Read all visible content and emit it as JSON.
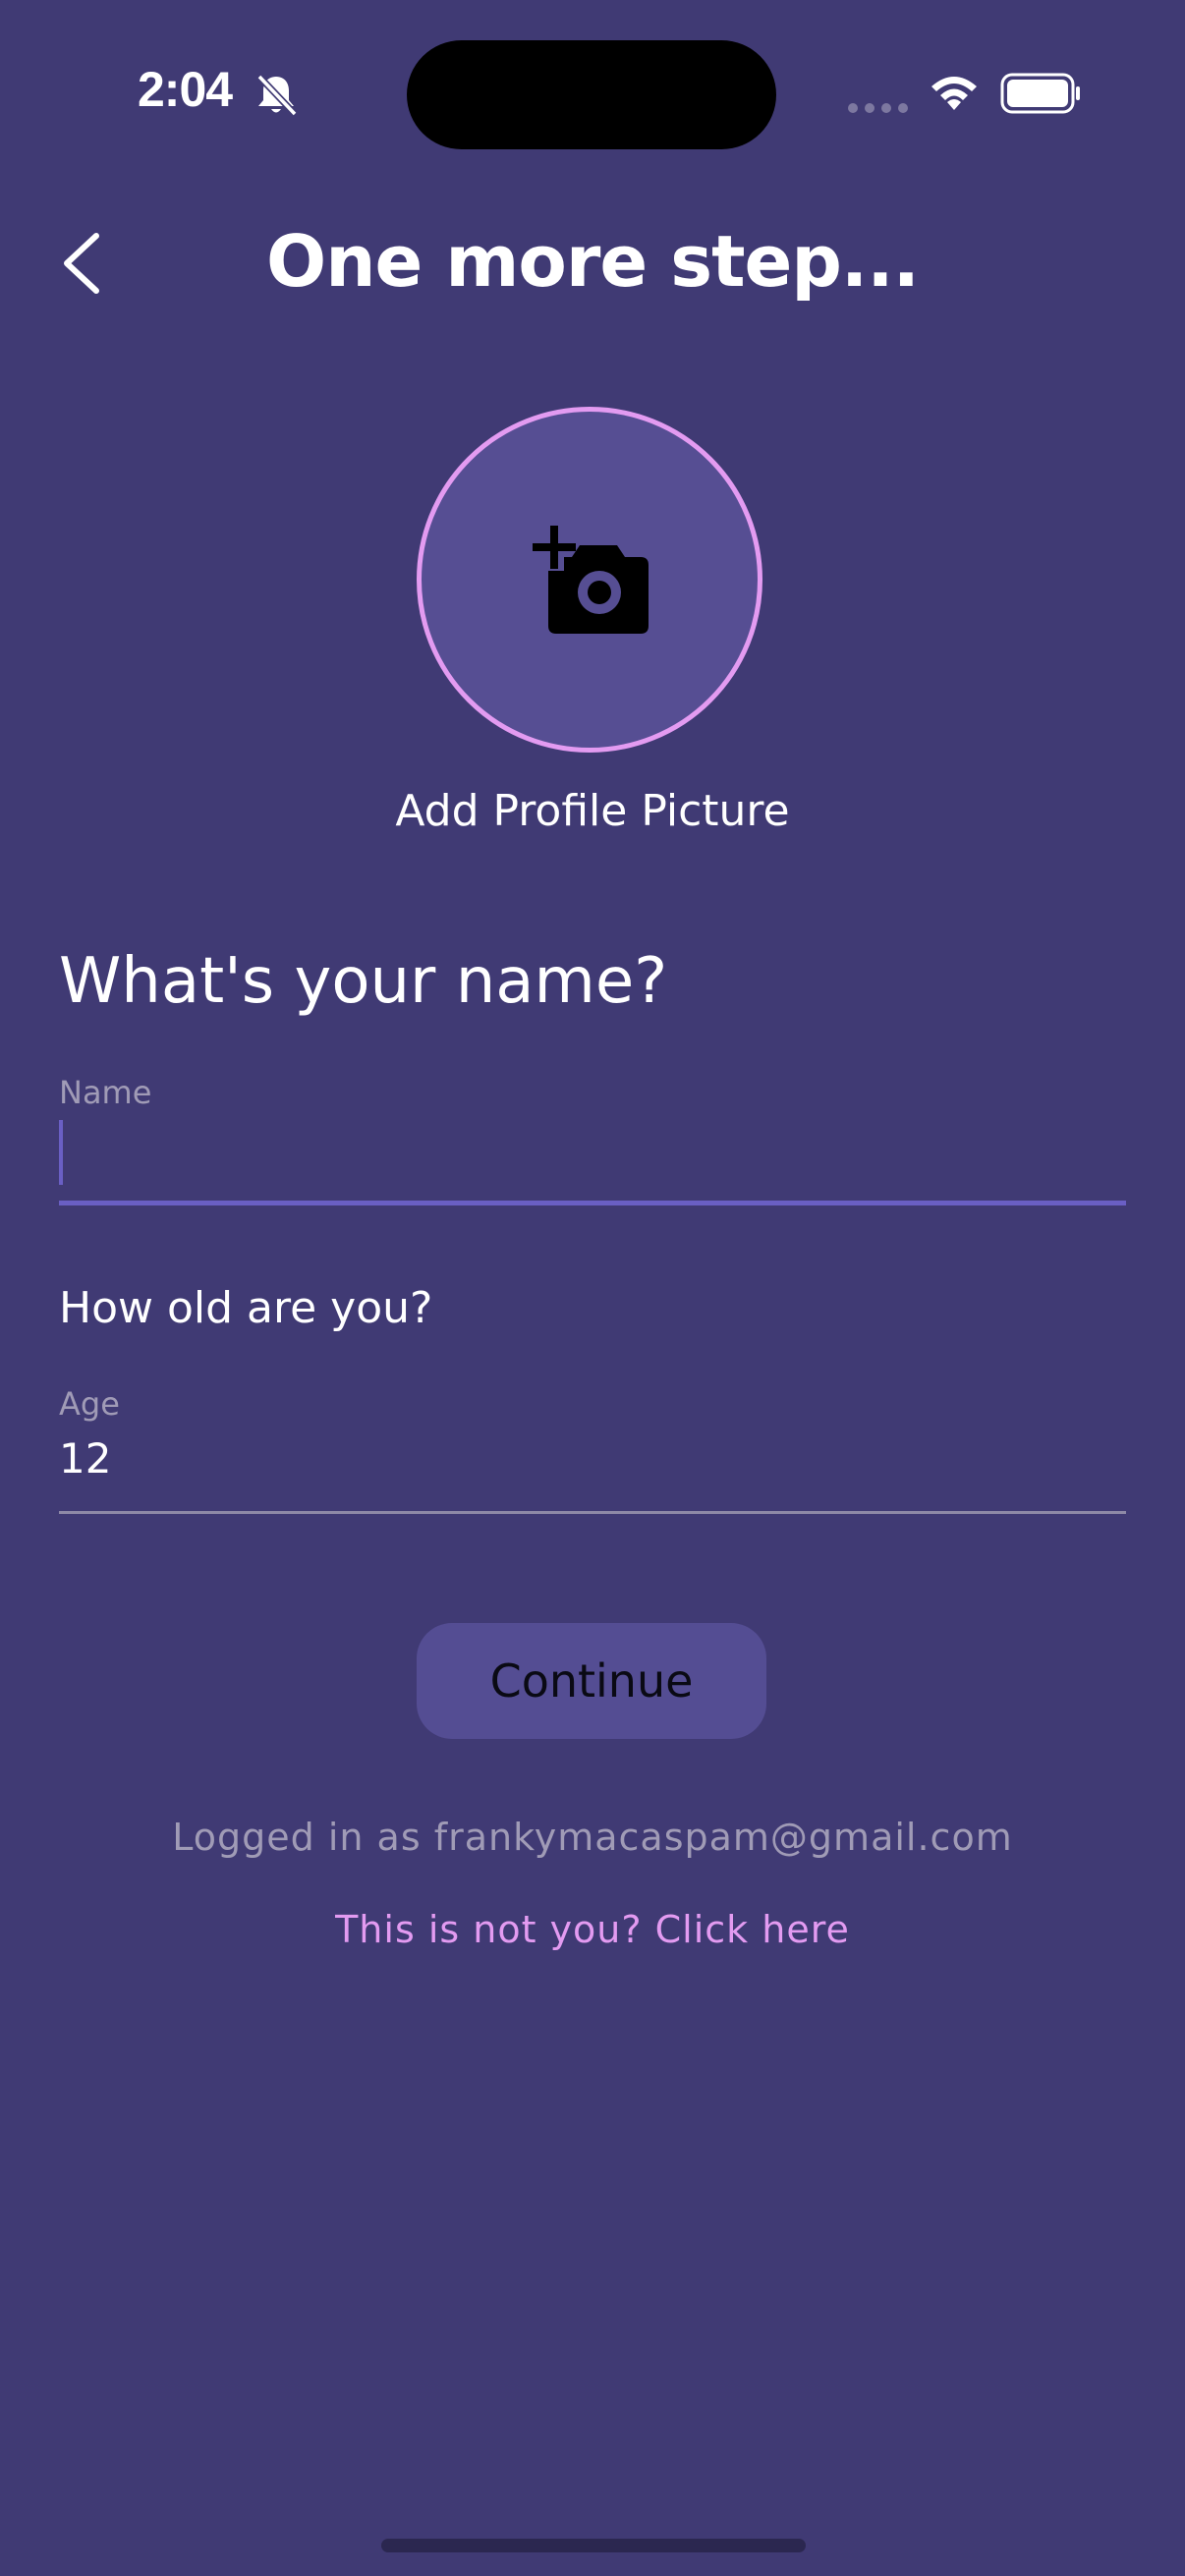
{
  "status_bar": {
    "time": "2:04"
  },
  "header": {
    "title": "One more step..."
  },
  "avatar": {
    "label": "Add Profile Picture"
  },
  "name_section": {
    "title": "What's your name?",
    "label": "Name",
    "value": ""
  },
  "age_section": {
    "title": "How old are you?",
    "label": "Age",
    "value": "12"
  },
  "actions": {
    "continue_label": "Continue",
    "logged_in_text": "Logged in as frankymacaspam@gmail.com",
    "switch_link": "This is not you? Click here"
  },
  "colors": {
    "background": "#403a74",
    "accent_pink": "#e39bf1",
    "accent_purple": "#6a5fc4",
    "button_bg": "#544d93"
  },
  "icons": {
    "back": "chevron-left-icon",
    "camera": "add-camera-icon",
    "bell": "bell-slash-icon",
    "wifi": "wifi-icon",
    "battery": "battery-icon"
  }
}
